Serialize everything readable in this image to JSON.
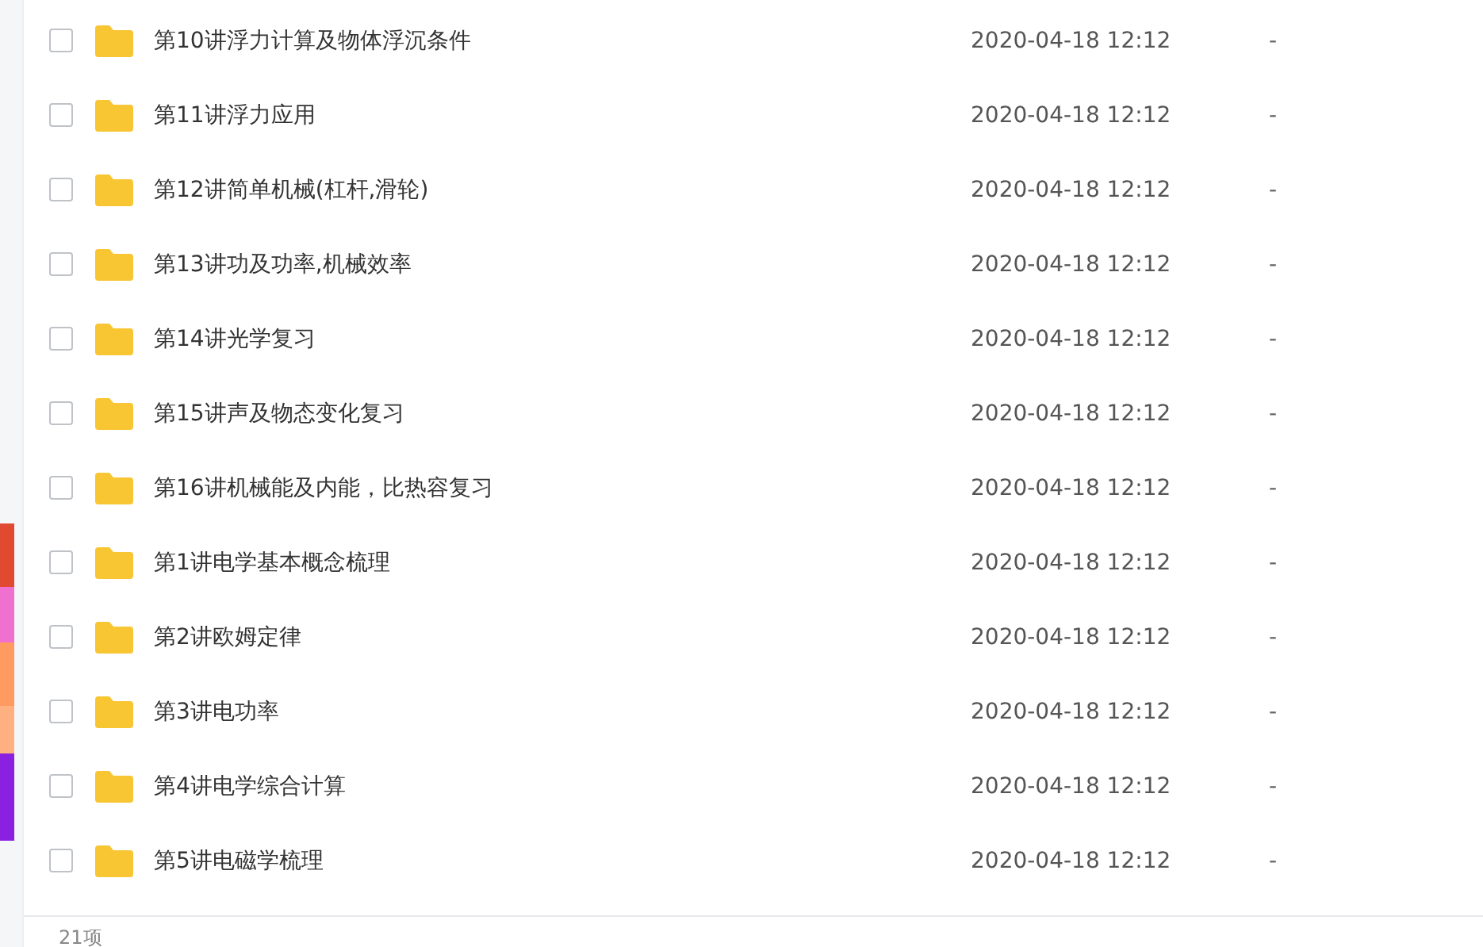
{
  "files": [
    {
      "name": "第10讲浮力计算及物体浮沉条件",
      "modified": "2020-04-18 12:12",
      "size": "-",
      "checked": false
    },
    {
      "name": "第11讲浮力应用",
      "modified": "2020-04-18 12:12",
      "size": "-",
      "checked": false
    },
    {
      "name": "第12讲简单机械(杠杆,滑轮)",
      "modified": "2020-04-18 12:12",
      "size": "-",
      "checked": false
    },
    {
      "name": "第13讲功及功率,机械效率",
      "modified": "2020-04-18 12:12",
      "size": "-",
      "checked": false
    },
    {
      "name": "第14讲光学复习",
      "modified": "2020-04-18 12:12",
      "size": "-",
      "checked": false
    },
    {
      "name": "第15讲声及物态变化复习",
      "modified": "2020-04-18 12:12",
      "size": "-",
      "checked": false
    },
    {
      "name": "第16讲机械能及内能，比热容复习",
      "modified": "2020-04-18 12:12",
      "size": "-",
      "checked": false
    },
    {
      "name": "第1讲电学基本概念梳理",
      "modified": "2020-04-18 12:12",
      "size": "-",
      "checked": false
    },
    {
      "name": "第2讲欧姆定律",
      "modified": "2020-04-18 12:12",
      "size": "-",
      "checked": false
    },
    {
      "name": "第3讲电功率",
      "modified": "2020-04-18 12:12",
      "size": "-",
      "checked": false
    },
    {
      "name": "第4讲电学综合计算",
      "modified": "2020-04-18 12:12",
      "size": "-",
      "checked": false
    },
    {
      "name": "第5讲电磁学梳理",
      "modified": "2020-04-18 12:12",
      "size": "-",
      "checked": false
    }
  ],
  "status_bar": {
    "count": "21项"
  }
}
